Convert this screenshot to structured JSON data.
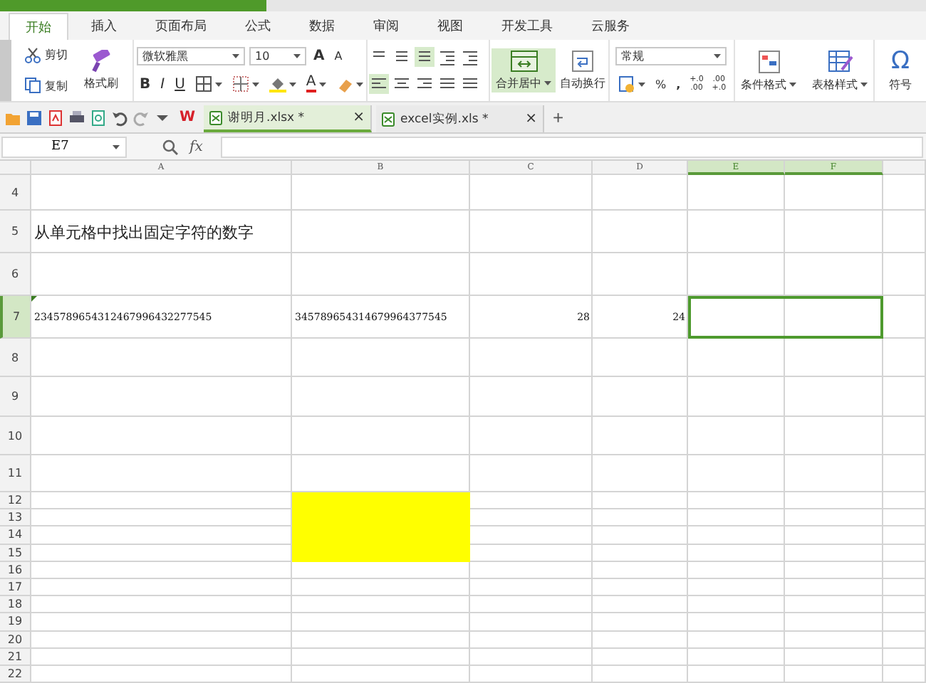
{
  "menu_tabs": [
    {
      "label": "开始",
      "selected": true
    },
    {
      "label": "插入",
      "selected": false
    },
    {
      "label": "页面布局",
      "selected": false
    },
    {
      "label": "公式",
      "selected": false
    },
    {
      "label": "数据",
      "selected": false
    },
    {
      "label": "审阅",
      "selected": false
    },
    {
      "label": "视图",
      "selected": false
    },
    {
      "label": "开发工具",
      "selected": false
    },
    {
      "label": "云服务",
      "selected": false
    }
  ],
  "ribbon": {
    "cut": "剪切",
    "copy": "复制",
    "format_painter": "格式刷",
    "font_name": "微软雅黑",
    "font_size": "10",
    "grow_font": "A",
    "shrink_font": "A",
    "bold": "B",
    "italic": "I",
    "underline": "U",
    "font_color": "A",
    "merge_center": "合并居中",
    "wrap_text": "自动换行",
    "number_format": "常规",
    "percent": "%",
    "comma": ",",
    "increase_decimal": "+.0 .00",
    "decrease_decimal": ".00 +.0",
    "conditional_format": "条件格式",
    "table_style": "表格样式",
    "symbol_glyph": "Ω",
    "symbol": "符号"
  },
  "quick_bar": {
    "app_logo": "W",
    "new_tab": "+",
    "documents": [
      {
        "name": "谢明月.xlsx *",
        "close": "×",
        "selected": true
      },
      {
        "name": "excel实例.xls *",
        "close": "×",
        "selected": false
      }
    ]
  },
  "formula_bar": {
    "name_box": "E7",
    "function_glyph": "fx"
  },
  "sheet": {
    "columns": [
      {
        "label": "A",
        "selected": false
      },
      {
        "label": "B",
        "selected": false
      },
      {
        "label": "C",
        "selected": false
      },
      {
        "label": "D",
        "selected": false
      },
      {
        "label": "E",
        "selected": true
      },
      {
        "label": "F",
        "selected": true
      }
    ],
    "rows": [
      {
        "header": "4",
        "selected": false
      },
      {
        "header": "5",
        "selected": false,
        "cells": {
          "A": {
            "kind": "heading",
            "text": "从单元格中找出固定字符的数字",
            "flagged": false
          }
        }
      },
      {
        "header": "6",
        "selected": false
      },
      {
        "header": "7",
        "selected": true,
        "cells": {
          "A": {
            "kind": "text",
            "text": "2345789654312467996432277545",
            "flagged": true
          },
          "B": {
            "kind": "text",
            "text": "345789654314679964377545",
            "flagged": false
          },
          "C": {
            "kind": "number",
            "text": "28",
            "flagged": false
          },
          "D": {
            "kind": "number",
            "text": "24",
            "flagged": false
          }
        }
      },
      {
        "header": "8",
        "selected": false
      },
      {
        "header": "9",
        "selected": false
      },
      {
        "header": "10",
        "selected": false
      },
      {
        "header": "11",
        "selected": false
      },
      {
        "header": "12",
        "selected": false,
        "fills": {
          "B": {
            "color": "#ffff00"
          }
        }
      },
      {
        "header": "13",
        "selected": false,
        "fills": {
          "B": {
            "color": "#ffff00"
          }
        }
      },
      {
        "header": "14",
        "selected": false,
        "fills": {
          "B": {
            "color": "#ffff00"
          }
        }
      },
      {
        "header": "15",
        "selected": false,
        "fills": {
          "B": {
            "color": "#ffff00"
          }
        }
      },
      {
        "header": "16",
        "selected": false
      },
      {
        "header": "17",
        "selected": false
      },
      {
        "header": "18",
        "selected": false
      },
      {
        "header": "19",
        "selected": false
      },
      {
        "header": "20",
        "selected": false
      },
      {
        "header": "21",
        "selected": false
      },
      {
        "header": "22",
        "selected": false
      }
    ]
  }
}
